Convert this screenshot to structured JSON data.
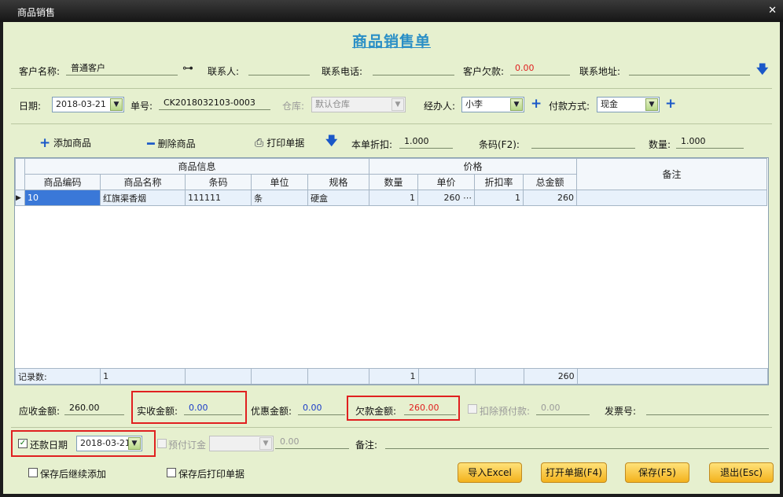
{
  "window": {
    "title": "商品销售"
  },
  "form_title": "商品销售单",
  "row1": {
    "customer_label": "客户名称:",
    "customer_value": "普通客户",
    "contact_label": "联系人:",
    "contact_value": "",
    "phone_label": "联系电话:",
    "phone_value": "",
    "debt_label": "客户欠款:",
    "debt_value": "0.00",
    "address_label": "联系地址:",
    "address_value": ""
  },
  "row2": {
    "date_label": "日期:",
    "date_value": "2018-03-21",
    "no_label": "单号:",
    "no_value": "CK2018032103-0003",
    "warehouse_label": "仓库:",
    "warehouse_value": "默认仓库",
    "handler_label": "经办人:",
    "handler_value": "小李",
    "payment_label": "付款方式:",
    "payment_value": "现金"
  },
  "toolbar": {
    "add_label": "添加商品",
    "delete_label": "删除商品",
    "print_label": "打印单据",
    "discount_label": "本单折扣:",
    "discount_value": "1.000",
    "barcode_label": "条码(F2):",
    "barcode_value": "",
    "qty_label": "数量:",
    "qty_value": "1.000"
  },
  "grid": {
    "group_headers": {
      "product_info": "商品信息",
      "price": "价格",
      "note": "备注"
    },
    "columns": [
      "商品编码",
      "商品名称",
      "条码",
      "单位",
      "规格",
      "数量",
      "单价",
      "折扣率",
      "总金额"
    ],
    "rows": [
      {
        "code": "10",
        "name": "红旗渠香烟",
        "barcode": "111111",
        "unit": "条",
        "spec": "硬盒",
        "qty": "1",
        "price": "260",
        "rate": "1",
        "total": "260",
        "note": ""
      }
    ],
    "footer": {
      "label": "记录数:",
      "count": "1",
      "qty": "1",
      "total": "260"
    }
  },
  "summary": {
    "receivable_label": "应收金额:",
    "receivable_value": "260.00",
    "received_label": "实收金额:",
    "received_value": "0.00",
    "discount_amt_label": "优惠金额:",
    "discount_amt_value": "0.00",
    "owed_label": "欠款金额:",
    "owed_value": "260.00",
    "deduct_label": "扣除预付款:",
    "deduct_value": "0.00",
    "invoice_label": "发票号:",
    "invoice_value": ""
  },
  "row_repay": {
    "repay_label": "还款日期",
    "repay_date": "2018-03-21",
    "prepay_label": "预付订金",
    "prepay_value": "0.00",
    "note_label": "备注:",
    "note_value": ""
  },
  "bottom": {
    "save_continue_label": "保存后继续添加",
    "save_print_label": "保存后打印单据",
    "export_label": "导入Excel",
    "open_label": "打开单据(F4)",
    "save_label": "保存(F5)",
    "exit_label": "退出(Esc)"
  }
}
